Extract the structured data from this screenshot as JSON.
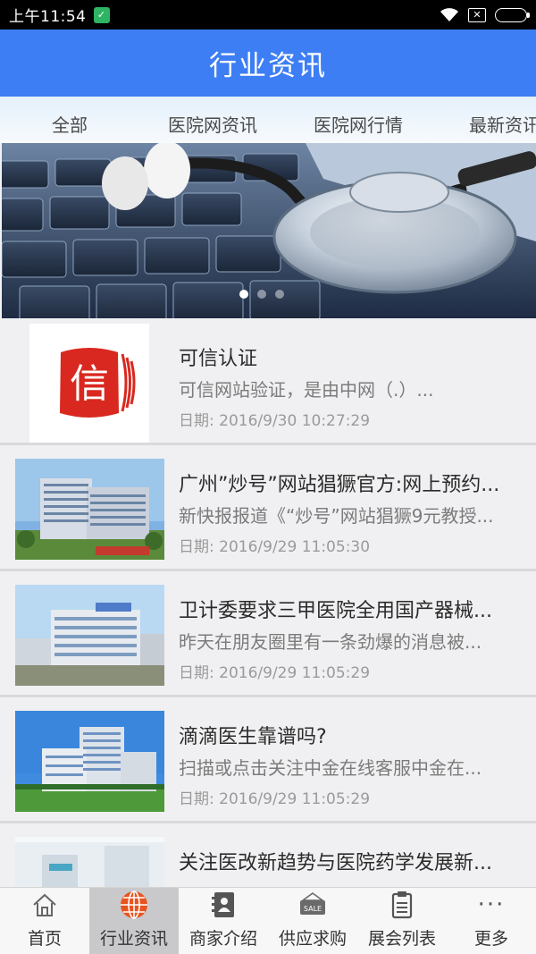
{
  "status_bar": {
    "time": "上午11:54",
    "shield_glyph": "✓",
    "sim_glyph": "✕"
  },
  "header": {
    "title": "行业资讯"
  },
  "tabs": [
    "全部",
    "医院网资讯",
    "医院网行情",
    "最新资讯"
  ],
  "banner": {
    "slide_count": 3,
    "active_slide": 1
  },
  "news": [
    {
      "title": "可信认证",
      "summary": "可信网站验证，是由中网（.）...",
      "date": "日期: 2016/9/30 10:27:29",
      "thumb_text": "信"
    },
    {
      "title": "广州”炒号”网站猖獗官方:网上预约...",
      "summary": "新快报报道《“炒号”网站猖獗9元教授...",
      "date": "日期: 2016/9/29 11:05:30"
    },
    {
      "title": "卫计委要求三甲医院全用国产器械...",
      "summary": "昨天在朋友圈里有一条劲爆的消息被...",
      "date": "日期: 2016/9/29 11:05:29"
    },
    {
      "title": "滴滴医生靠谱吗?",
      "summary": "扫描或点击关注中金在线客服中金在...",
      "date": "日期: 2016/9/29 11:05:29"
    },
    {
      "title": "关注医改新趋势与医院药学发展新...",
      "summary": "",
      "date": ""
    }
  ],
  "bottom_nav": [
    {
      "label": "首页",
      "icon": "home-icon"
    },
    {
      "label": "行业资讯",
      "icon": "globe-icon",
      "active": true
    },
    {
      "label": "商家介绍",
      "icon": "contacts-book-icon"
    },
    {
      "label": "供应求购",
      "icon": "sale-tag-icon",
      "icon_text": "SALE"
    },
    {
      "label": "展会列表",
      "icon": "clipboard-icon"
    },
    {
      "label": "更多",
      "icon": "more-dots-icon",
      "icon_text": "···"
    }
  ],
  "colors": {
    "header": "#3d7ef4",
    "accent": "#e8541e",
    "badge_red": "#d9281f"
  }
}
